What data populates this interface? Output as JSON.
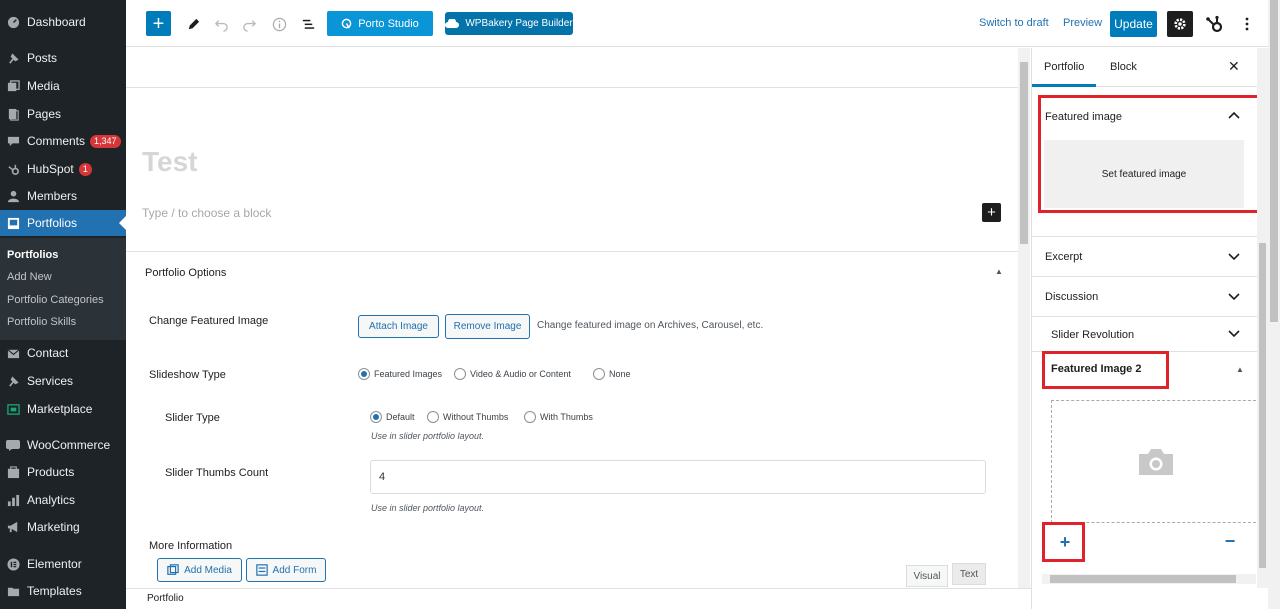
{
  "admin_menu": {
    "items": [
      {
        "label": "Dashboard",
        "icon": "dashboard-icon"
      },
      {
        "label": "Posts",
        "icon": "pin-icon"
      },
      {
        "label": "Media",
        "icon": "media-icon"
      },
      {
        "label": "Pages",
        "icon": "pages-icon"
      },
      {
        "label": "Comments",
        "icon": "comment-icon",
        "badge": "1,347"
      },
      {
        "label": "HubSpot",
        "icon": "hubspot-icon",
        "badge": "1"
      },
      {
        "label": "Members",
        "icon": "members-icon"
      },
      {
        "label": "Portfolios",
        "icon": "portfolio-icon"
      },
      {
        "label": "Contact",
        "icon": "mail-icon"
      },
      {
        "label": "Services",
        "icon": "pin-icon"
      },
      {
        "label": "Marketplace",
        "icon": "marketplace-icon"
      },
      {
        "label": "WooCommerce",
        "icon": "woo-icon"
      },
      {
        "label": "Products",
        "icon": "products-icon"
      },
      {
        "label": "Analytics",
        "icon": "analytics-icon"
      },
      {
        "label": "Marketing",
        "icon": "megaphone-icon"
      },
      {
        "label": "Elementor",
        "icon": "elementor-icon"
      },
      {
        "label": "Templates",
        "icon": "folder-icon"
      }
    ],
    "submenu": [
      "Portfolios",
      "Add New",
      "Portfolio Categories",
      "Portfolio Skills"
    ]
  },
  "toolbar": {
    "porto_label": "Porto Studio",
    "wpbakery_label": "WPBakery Page Builder",
    "switch_draft": "Switch to draft",
    "preview": "Preview",
    "update": "Update"
  },
  "editor": {
    "title": "Test",
    "block_placeholder": "Type / to choose a block"
  },
  "portfolio_options": {
    "title": "Portfolio Options",
    "change_featured_label": "Change Featured Image",
    "attach_image": "Attach Image",
    "remove_image": "Remove Image",
    "change_featured_hint": "Change featured image on Archives, Carousel, etc.",
    "slideshow_type_label": "Slideshow Type",
    "slideshow_options": [
      "Featured Images",
      "Video & Audio or Content",
      "None"
    ],
    "slideshow_selected": "Featured Images",
    "slider_type_label": "Slider Type",
    "slider_type_options": [
      "Default",
      "Without Thumbs",
      "With Thumbs"
    ],
    "slider_type_selected": "Default",
    "slider_layout_hint": "Use in slider portfolio layout.",
    "thumbs_count_label": "Slider Thumbs Count",
    "thumbs_count_value": "4",
    "thumbs_hint": "Use in slider portfolio layout.",
    "more_info_label": "More Information",
    "add_media": "Add Media",
    "add_form": "Add Form",
    "tab_visual": "Visual",
    "tab_text": "Text"
  },
  "footer": {
    "breadcrumb": "Portfolio"
  },
  "settings_panel": {
    "tab_portfolio": "Portfolio",
    "tab_block": "Block",
    "featured_image_title": "Featured image",
    "set_featured_image": "Set featured image",
    "excerpt": "Excerpt",
    "discussion": "Discussion",
    "slider_revolution": "Slider Revolution",
    "featured_image_2_title": "Featured Image 2"
  },
  "colors": {
    "accent": "#007cba",
    "sidebar_bg": "#1d2327",
    "highlight_red": "#e0222b"
  }
}
